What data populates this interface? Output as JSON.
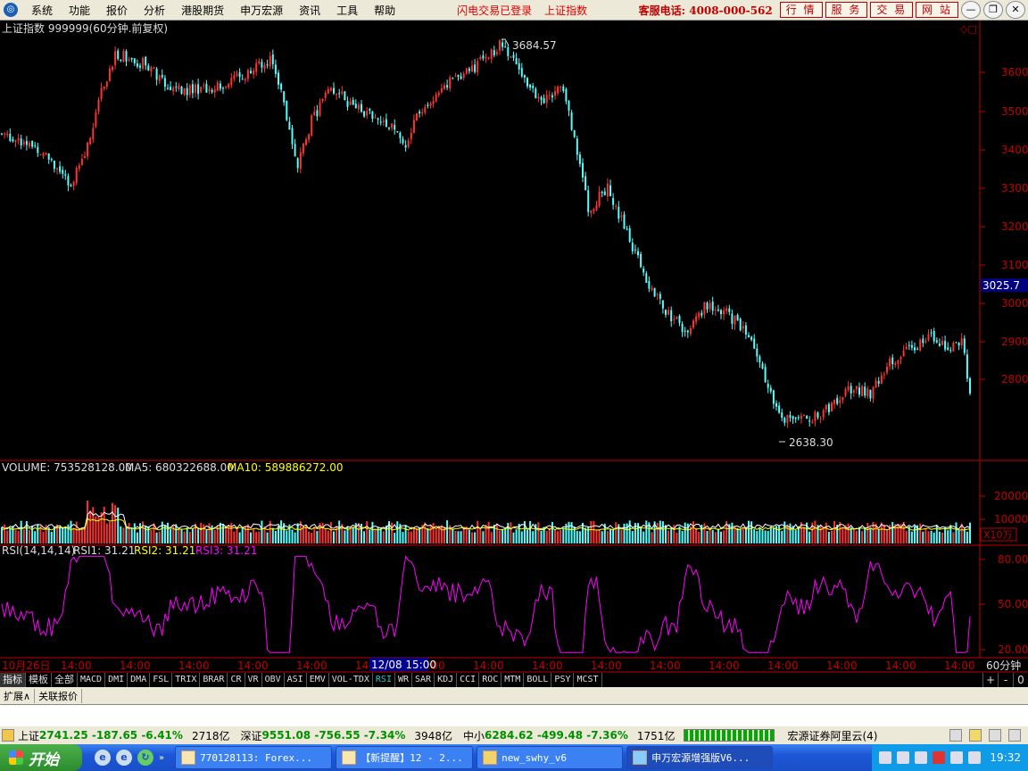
{
  "menubar": {
    "items": [
      "系统",
      "功能",
      "报价",
      "分析",
      "港股期货",
      "申万宏源",
      "资讯",
      "工具",
      "帮助"
    ],
    "status_1": "闪电交易已登录",
    "status_2": "上证指数",
    "hotline": "客服电话: 4008-000-562",
    "buttons": [
      "行 情",
      "服 务",
      "交 易",
      "网 站"
    ]
  },
  "main_chart": {
    "title": "上证指数 999999(60分钟.前复权)",
    "current_price": "3025.7",
    "high_label": "3684.57",
    "low_label": "2638.30",
    "y_ticks": [
      "3600",
      "3500",
      "3400",
      "3300",
      "3200",
      "3100",
      "3000",
      "2900",
      "2800"
    ]
  },
  "volume_panel": {
    "label": "VOLUME: 753528128.00",
    "ma5": "MA5: 680322688.00",
    "ma10": "MA10: 589886272.00",
    "ticks": [
      "20000",
      "10000"
    ],
    "unit": "X10万"
  },
  "rsi_panel": {
    "label": "RSI(14,14,14)",
    "rsi1": "RSI1: 31.21",
    "rsi2": "RSI2: 31.21",
    "rsi3": "RSI3: 31.21",
    "ticks": [
      "80.00",
      "50.00",
      "20.00"
    ]
  },
  "time_axis": {
    "labels": [
      "10月26日",
      "14:00",
      "14:00",
      "14:00",
      "14:00",
      "14:00",
      "14:00",
      "14:00",
      "14:00",
      "14:00",
      "14:00",
      "14:00",
      "14:00",
      "14:00",
      "14:00",
      "14:00",
      "14:00",
      "14:00"
    ],
    "cursor_label": "12/08 15:00",
    "period": "60分钟"
  },
  "indicator_tabs": [
    "指标",
    "模板",
    "全部",
    "MACD",
    "DMI",
    "DMA",
    "FSL",
    "TRIX",
    "BRAR",
    "CR",
    "VR",
    "OBV",
    "ASI",
    "EMV",
    "VOL-TDX",
    "RSI",
    "WR",
    "SAR",
    "KDJ",
    "CCI",
    "ROC",
    "MTM",
    "BOLL",
    "PSY",
    "MCST"
  ],
  "tab_controls": [
    "+",
    "-",
    "0"
  ],
  "bottom_tabs": [
    "扩展∧",
    "关联报价"
  ],
  "ticker": {
    "sh_label": "上证",
    "sh_value": "2741.25 -187.65 -6.41%",
    "sh_vol": "2718亿",
    "sz_label": "深证",
    "sz_value": "9551.08 -756.55 -7.34%",
    "sz_vol": "3948亿",
    "zx_label": "中小",
    "zx_value": "6284.62 -499.48 -7.36%",
    "zx_vol": "1751亿",
    "broker": "宏源证券阿里云(4)"
  },
  "taskbar": {
    "start": "开始",
    "tasks": [
      "770128113: Forex...",
      "【新提醒】12 - 2...",
      "new_swhy_v6",
      "申万宏源增强版V6..."
    ],
    "clock": "19:32"
  },
  "colors": {
    "up": "#ff3232",
    "down": "#54ffff",
    "axis": "#c00000",
    "ma5": "#ffffff",
    "ma10": "#ffff00",
    "rsi": "#ff00ff"
  }
}
